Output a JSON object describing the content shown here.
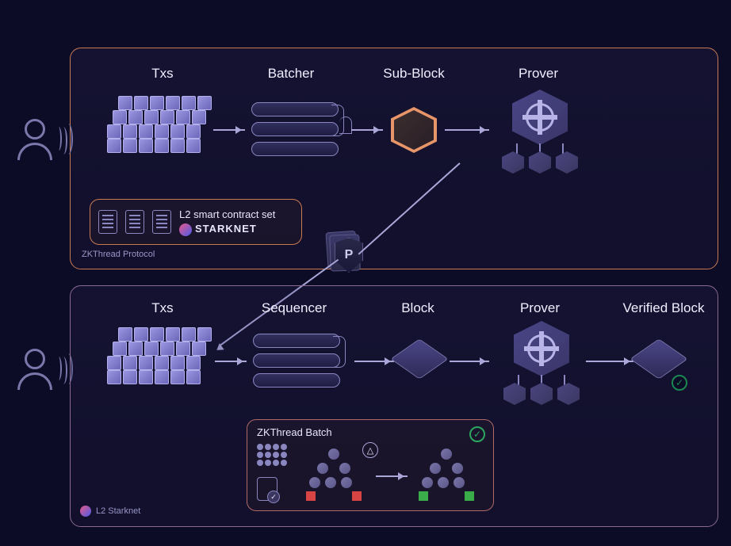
{
  "top": {
    "title": "ZKThread Protocol",
    "labels": {
      "txs": "Txs",
      "batcher": "Batcher",
      "subblock": "Sub-Block",
      "prover": "Prover"
    },
    "contract": {
      "line1": "L2 smart contract set",
      "line2": "STARKNET"
    },
    "shield": "P"
  },
  "bottom": {
    "title": "L2 Starknet",
    "labels": {
      "txs": "Txs",
      "sequencer": "Sequencer",
      "block": "Block",
      "prover": "Prover",
      "verified": "Verified Block"
    },
    "batch": {
      "title": "ZKThread Batch"
    }
  }
}
